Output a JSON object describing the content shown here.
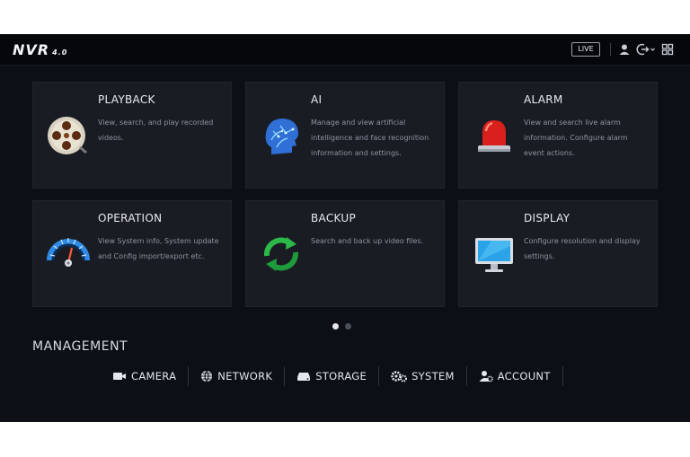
{
  "header": {
    "logo": "NVR",
    "logo_version": "4.0",
    "live_label": "LIVE",
    "icons": [
      "user-icon",
      "logout-icon",
      "grid-icon"
    ]
  },
  "cards": [
    {
      "title": "PLAYBACK",
      "desc": "View, search, and play recorded videos.",
      "icon": "film-reel-icon"
    },
    {
      "title": "AI",
      "desc": "Manage and view artificial intelligence and face recognition information and settings.",
      "icon": "ai-head-icon"
    },
    {
      "title": "ALARM",
      "desc": "View and search live alarm information. Configure alarm event actions.",
      "icon": "alarm-siren-icon"
    },
    {
      "title": "OPERATION",
      "desc": "View System info, System update and Config import/export etc.",
      "icon": "gauge-icon"
    },
    {
      "title": "BACKUP",
      "desc": "Search and back up video files.",
      "icon": "refresh-arrows-icon"
    },
    {
      "title": "DISPLAY",
      "desc": "Configure resolution and display settings.",
      "icon": "monitor-icon"
    }
  ],
  "pagination": {
    "total": 2,
    "active": 1
  },
  "management": {
    "title": "MANAGEMENT",
    "items": [
      {
        "label": "CAMERA",
        "icon": "camera-icon"
      },
      {
        "label": "NETWORK",
        "icon": "globe-icon"
      },
      {
        "label": "STORAGE",
        "icon": "hard-drive-icon"
      },
      {
        "label": "SYSTEM",
        "icon": "gears-icon"
      },
      {
        "label": "ACCOUNT",
        "icon": "user-gear-icon"
      }
    ]
  },
  "colors": {
    "background": "#0c0f16",
    "card": "#191c23",
    "accent_blue": "#2f8be6",
    "alarm_red": "#d8201c",
    "backup_green": "#2db84a"
  }
}
